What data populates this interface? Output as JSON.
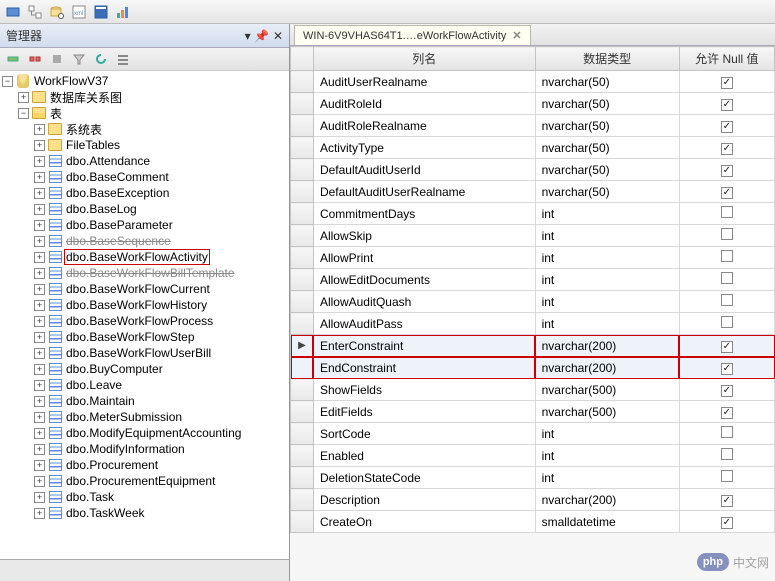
{
  "toolbar_icons": [
    "sql-icon",
    "tree-icon",
    "search-db-icon",
    "xml-icon",
    "window-icon",
    "chart-icon"
  ],
  "left_panel": {
    "title": "管理器",
    "toolbar_icons": [
      "connect-icon",
      "disconnect-icon",
      "stop-icon",
      "filter-icon",
      "refresh-icon",
      "list-icon"
    ],
    "root": {
      "db_name": "WorkFlowV37",
      "folders": [
        {
          "label": "数据库关系图",
          "expanded": false
        },
        {
          "label": "表",
          "expanded": true,
          "children_folders": [
            {
              "label": "系统表"
            },
            {
              "label": "FileTables"
            }
          ],
          "tables": [
            {
              "label": "dbo.Attendance"
            },
            {
              "label": "dbo.BaseComment"
            },
            {
              "label": "dbo.BaseException"
            },
            {
              "label": "dbo.BaseLog"
            },
            {
              "label": "dbo.BaseParameter"
            },
            {
              "label": "dbo.BaseSequence",
              "strike": true
            },
            {
              "label": "dbo.BaseWorkFlowActivity",
              "highlight": true
            },
            {
              "label": "dbo.BaseWorkFlowBillTemplate",
              "strike": true
            },
            {
              "label": "dbo.BaseWorkFlowCurrent"
            },
            {
              "label": "dbo.BaseWorkFlowHistory"
            },
            {
              "label": "dbo.BaseWorkFlowProcess"
            },
            {
              "label": "dbo.BaseWorkFlowStep"
            },
            {
              "label": "dbo.BaseWorkFlowUserBill"
            },
            {
              "label": "dbo.BuyComputer"
            },
            {
              "label": "dbo.Leave"
            },
            {
              "label": "dbo.Maintain"
            },
            {
              "label": "dbo.MeterSubmission"
            },
            {
              "label": "dbo.ModifyEquipmentAccounting"
            },
            {
              "label": "dbo.ModifyInformation"
            },
            {
              "label": "dbo.Procurement"
            },
            {
              "label": "dbo.ProcurementEquipment"
            },
            {
              "label": "dbo.Task"
            },
            {
              "label": "dbo.TaskWeek"
            }
          ]
        }
      ]
    }
  },
  "doc_tab": "WIN-6V9VHAS64T1.…eWorkFlowActivity",
  "grid": {
    "headers": {
      "name": "列名",
      "type": "数据类型",
      "nulls": "允许 Null 值"
    },
    "rows": [
      {
        "name": "AuditUserRealname",
        "type": "nvarchar(50)",
        "null": true
      },
      {
        "name": "AuditRoleId",
        "type": "nvarchar(50)",
        "null": true
      },
      {
        "name": "AuditRoleRealname",
        "type": "nvarchar(50)",
        "null": true
      },
      {
        "name": "ActivityType",
        "type": "nvarchar(50)",
        "null": true
      },
      {
        "name": "DefaultAuditUserId",
        "type": "nvarchar(50)",
        "null": true
      },
      {
        "name": "DefaultAuditUserRealname",
        "type": "nvarchar(50)",
        "null": true
      },
      {
        "name": "CommitmentDays",
        "type": "int",
        "null": false
      },
      {
        "name": "AllowSkip",
        "type": "int",
        "null": false
      },
      {
        "name": "AllowPrint",
        "type": "int",
        "null": false
      },
      {
        "name": "AllowEditDocuments",
        "type": "int",
        "null": false
      },
      {
        "name": "AllowAuditQuash",
        "type": "int",
        "null": false
      },
      {
        "name": "AllowAuditPass",
        "type": "int",
        "null": false
      },
      {
        "name": "EnterConstraint",
        "type": "nvarchar(200)",
        "null": true,
        "selected": true,
        "current": true,
        "redbox": true
      },
      {
        "name": "EndConstraint",
        "type": "nvarchar(200)",
        "null": true,
        "selected": true,
        "redbox": true
      },
      {
        "name": "ShowFields",
        "type": "nvarchar(500)",
        "null": true
      },
      {
        "name": "EditFields",
        "type": "nvarchar(500)",
        "null": true
      },
      {
        "name": "SortCode",
        "type": "int",
        "null": false
      },
      {
        "name": "Enabled",
        "type": "int",
        "null": false
      },
      {
        "name": "DeletionStateCode",
        "type": "int",
        "null": false
      },
      {
        "name": "Description",
        "type": "nvarchar(200)",
        "null": true
      },
      {
        "name": "CreateOn",
        "type": "smalldatetime",
        "null": true
      }
    ]
  },
  "watermark": {
    "badge": "php",
    "text": "中文网"
  }
}
